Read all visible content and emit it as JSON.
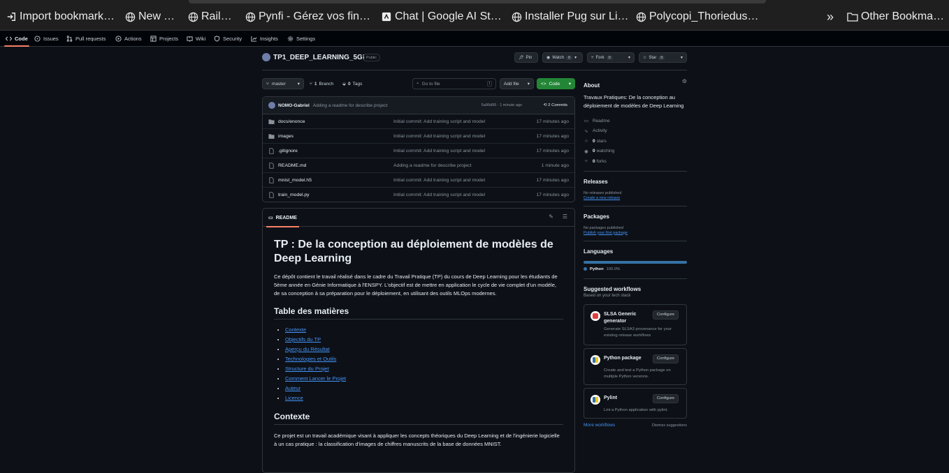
{
  "bookmarks": {
    "items": [
      {
        "label": "Import bookmarks…",
        "icon": "import-icon"
      },
      {
        "label": "New Tab",
        "icon": "globe-icon"
      },
      {
        "label": "Railway",
        "icon": "globe-icon"
      },
      {
        "label": "Pynfi - Gérez vos finan…",
        "icon": "globe-icon"
      },
      {
        "label": "Chat | Google AI Studio",
        "icon": "ai-studio-icon"
      },
      {
        "label": "Installer Pug sur Linux",
        "icon": "globe-icon"
      },
      {
        "label": "Polycopi_Thoriedusig…",
        "icon": "globe-icon"
      }
    ],
    "overflow": "»",
    "other": "Other Bookmarks"
  },
  "repo_nav": {
    "tabs": [
      {
        "label": "Code",
        "icon": "code-icon",
        "active": true
      },
      {
        "label": "Issues",
        "icon": "issue-icon"
      },
      {
        "label": "Pull requests",
        "icon": "pull-request-icon"
      },
      {
        "label": "Actions",
        "icon": "play-icon"
      },
      {
        "label": "Projects",
        "icon": "table-icon"
      },
      {
        "label": "Wiki",
        "icon": "book-icon"
      },
      {
        "label": "Security",
        "icon": "shield-icon"
      },
      {
        "label": "Insights",
        "icon": "graph-icon"
      },
      {
        "label": "Settings",
        "icon": "gear-icon"
      }
    ]
  },
  "repo": {
    "name": "TP1_DEEP_LEARNING_5GI",
    "visibility": "Public",
    "pin": "Pin",
    "watch": "Watch",
    "watch_count": "0",
    "fork": "Fork",
    "fork_count": "0",
    "star": "Star",
    "star_count": "0"
  },
  "toolbar": {
    "branch": "master",
    "branch_count": "1",
    "branch_label": "Branch",
    "tag_count": "0",
    "tag_label": "Tags",
    "goto_placeholder": "Go to file",
    "goto_key": "t",
    "add_file": "Add file",
    "code": "Code"
  },
  "commit": {
    "author": "NOMO-Gabriel",
    "message": "Adding a readme for describe project",
    "hash_time": "5a96d95 · 1 minute ago",
    "commits": "2 Commits"
  },
  "files": [
    {
      "name": "docs/enonce",
      "type": "folder",
      "message": "Initial commit: Add training script and model",
      "time": "17 minutes ago"
    },
    {
      "name": "images",
      "type": "folder",
      "message": "Initial commit: Add training script and model",
      "time": "17 minutes ago"
    },
    {
      "name": ".gitignore",
      "type": "file",
      "message": "Initial commit: Add training script and model",
      "time": "17 minutes ago"
    },
    {
      "name": "README.md",
      "type": "file",
      "message": "Adding a readme for describe project",
      "time": "1 minute ago"
    },
    {
      "name": "mnist_model.h5",
      "type": "file",
      "message": "Initial commit: Add training script and model",
      "time": "17 minutes ago"
    },
    {
      "name": "train_model.py",
      "type": "file",
      "message": "Initial commit: Add training script and model",
      "time": "17 minutes ago"
    }
  ],
  "readme": {
    "tab": "README",
    "title": "TP : De la conception au déploiement de modèles de Deep Learning",
    "intro": "Ce dépôt contient le travail réalisé dans le cadre du Travail Pratique (TP) du cours de Deep Learning pour les étudiants de 5ème année en Génie Informatique à l'ENSPY. L'objectif est de mettre en application le cycle de vie complet d'un modèle, de sa conception à sa préparation pour le déploiement, en utilisant des outils MLOps modernes.",
    "toc_title": "Table des matières",
    "toc": [
      "Contexte",
      "Objectifs du TP",
      "Aperçu du Résultat",
      "Technologies et Outils",
      "Structure du Projet",
      "Comment Lancer le Projet",
      "Auteur",
      "Licence"
    ],
    "context_title": "Contexte",
    "context_text": "Ce projet est un travail académique visant à appliquer les concepts théoriques du Deep Learning et de l'ingénierie logicielle à un cas pratique : la classification d'images de chiffres manuscrits de la base de données MNIST."
  },
  "about": {
    "title": "About",
    "description": "Travaux Pratiques: De la conception au déploiement de modèles de Deep Learning",
    "readme": "Readme",
    "activity": "Activity",
    "stars_count": "0",
    "stars": "stars",
    "watching_count": "0",
    "watching": "watching",
    "forks_count": "0",
    "forks": "forks"
  },
  "releases": {
    "title": "Releases",
    "none": "No releases published",
    "create": "Create a new release"
  },
  "packages": {
    "title": "Packages",
    "none": "No packages published",
    "publish": "Publish your first package"
  },
  "languages": {
    "title": "Languages",
    "items": [
      {
        "name": "Python",
        "percent": "100.0%",
        "share": 1.0,
        "color": "#3572A5"
      }
    ]
  },
  "workflows": {
    "title": "Suggested workflows",
    "subtitle": "Based on your tech stack",
    "configure": "Configure",
    "items": [
      {
        "name": "SLSA Generic generator",
        "desc": "Generate SLSA3 provenance for your existing release workflows",
        "icon": "slsa-icon"
      },
      {
        "name": "Python package",
        "desc": "Create and test a Python package on multiple Python versions.",
        "icon": "python-icon"
      },
      {
        "name": "Pylint",
        "desc": "Lint a Python application with pylint.",
        "icon": "python-icon"
      }
    ],
    "more": "More workflows",
    "dismiss": "Dismiss suggestions"
  },
  "colors": {
    "accent": "#f78166",
    "link": "#4493f8",
    "primary_button": "#238636",
    "python": "#3572A5"
  }
}
